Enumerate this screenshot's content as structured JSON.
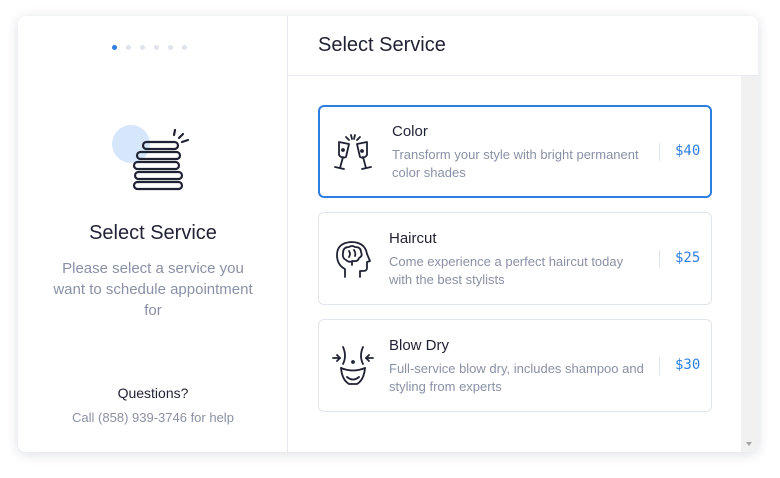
{
  "colors": {
    "accent": "#2d7ee0",
    "text": "#1f2233",
    "muted": "#8a91a6",
    "border": "#e1e5ec"
  },
  "sidebar": {
    "steps_total": 6,
    "step_active": 1,
    "illustration_icon": "stack-list-icon",
    "title": "Select Service",
    "description": "Please select a service you want to schedule appointment for",
    "questions_label": "Questions?",
    "help_text": "Call (858) 939-3746 for help"
  },
  "main": {
    "title": "Select Service",
    "services": [
      {
        "name": "Color",
        "description": "Transform your style with bright permanent color shades",
        "price": "$40",
        "icon": "champagne-glasses-icon",
        "selected": true
      },
      {
        "name": "Haircut",
        "description": "Come experience a perfect haircut today with the best stylists",
        "price": "$25",
        "icon": "head-brain-icon",
        "selected": false
      },
      {
        "name": "Blow Dry",
        "description": "Full-service blow dry, includes shampoo and styling from experts",
        "price": "$30",
        "icon": "waist-slim-icon",
        "selected": false
      }
    ]
  }
}
